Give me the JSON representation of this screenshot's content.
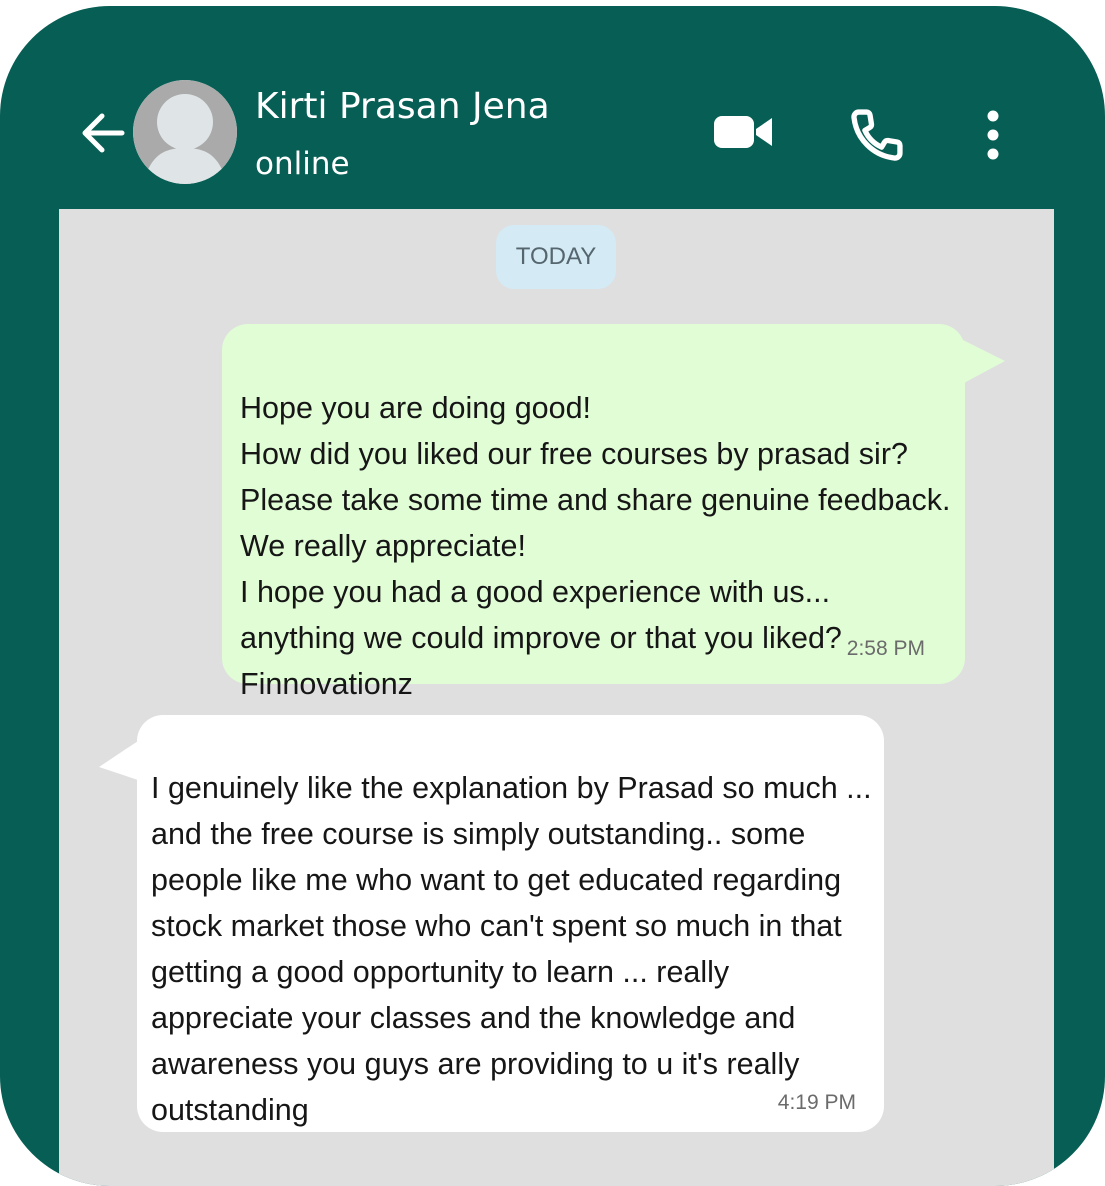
{
  "header": {
    "contact_name": "Kirti Prasan Jena",
    "status": "online",
    "back_icon": "arrow-left-icon",
    "video_icon": "video-camera-icon",
    "call_icon": "phone-icon",
    "more_icon": "more-vertical-icon"
  },
  "chat": {
    "date_label": "TODAY",
    "messages": [
      {
        "direction": "outgoing",
        "text": "Hope you are doing good!\nHow did you liked our free courses by prasad sir? Please take some time and share genuine feedback. We really appreciate!\nI hope you had a good experience with us... anything we could improve or that you liked?\nFinnovationz",
        "time": "2:58 PM"
      },
      {
        "direction": "incoming",
        "text": "I genuinely like the explanation by Prasad so much ... and the free course is simply outstanding.. some people like me who want to get educated regarding stock market those who can't spent so much in that getting a good opportunity to learn ... really appreciate your classes and the knowledge and awareness you guys are providing to u it's really outstanding",
        "time": "4:19 PM"
      }
    ]
  },
  "colors": {
    "header_bg": "#075E54",
    "chat_bg": "#DFDFDF",
    "outgoing_bubble": "#E1FDD6",
    "incoming_bubble": "#FFFFFF",
    "date_chip": "#D4EAF4"
  }
}
